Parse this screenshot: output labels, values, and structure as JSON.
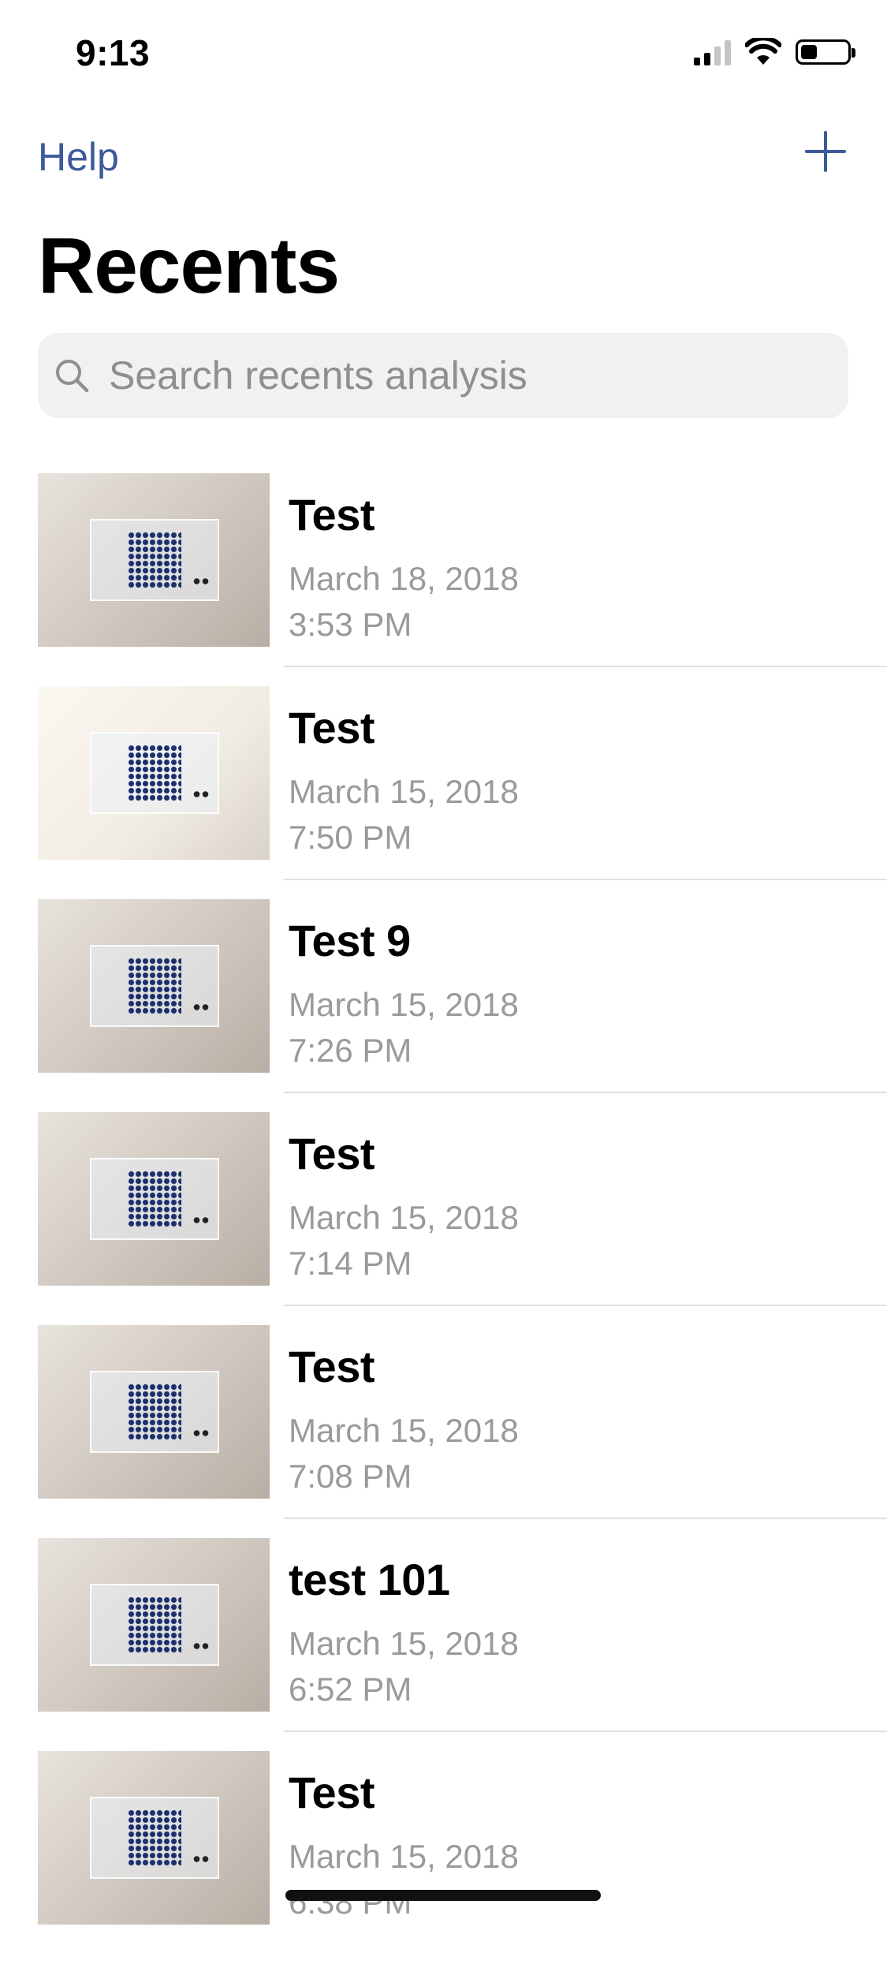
{
  "status_bar": {
    "time": "9:13",
    "signal_icon": "cellular-signal-icon",
    "wifi_icon": "wifi-icon",
    "battery_icon": "battery-icon",
    "battery_level": 0.35
  },
  "nav": {
    "help_label": "Help",
    "add_icon": "plus-icon"
  },
  "page_title": "Recents",
  "search": {
    "placeholder": "Search recents analysis",
    "icon": "search-icon",
    "value": ""
  },
  "recents": [
    {
      "title": "Test",
      "date": "March 18, 2018",
      "time": "3:53 PM",
      "thumbnail": "well-plate-photo"
    },
    {
      "title": "Test",
      "date": "March 15, 2018",
      "time": "7:50 PM",
      "thumbnail": "well-plate-photo"
    },
    {
      "title": "Test 9",
      "date": "March 15, 2018",
      "time": "7:26 PM",
      "thumbnail": "well-plate-photo"
    },
    {
      "title": "Test",
      "date": "March 15, 2018",
      "time": "7:14 PM",
      "thumbnail": "well-plate-photo"
    },
    {
      "title": "Test",
      "date": "March 15, 2018",
      "time": "7:08 PM",
      "thumbnail": "well-plate-photo"
    },
    {
      "title": "test 101",
      "date": "March 15, 2018",
      "time": "6:52 PM",
      "thumbnail": "well-plate-photo"
    },
    {
      "title": "Test",
      "date": "March 15, 2018",
      "time": "6:38 PM",
      "thumbnail": "well-plate-photo"
    }
  ],
  "colors": {
    "accent": "#3b5a9a",
    "secondary_text": "#9a9a9e",
    "search_bg": "#f1f1f2",
    "separator": "#e1e1e3"
  }
}
